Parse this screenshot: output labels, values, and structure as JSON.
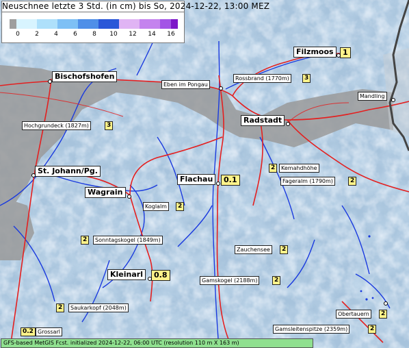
{
  "title": "Neuschnee letzte 3 Std. (in cm) bis So, 2024-12-22, 13:00 MEZ",
  "legend": {
    "ticks": [
      "0",
      "2",
      "4",
      "6",
      "8",
      "10",
      "12",
      "14",
      "16"
    ],
    "colors": [
      "#9e9e9e",
      "#d8f4ff",
      "#aee0fb",
      "#7ec0f5",
      "#4f8fe8",
      "#2a57d8",
      "#e0b4f4",
      "#c483ee",
      "#a354e6",
      "#7d18c8"
    ]
  },
  "places": [
    {
      "name": "Filzmoos",
      "value": "1",
      "size": "big"
    },
    {
      "name": "Bischofshofen",
      "value": "",
      "size": "big"
    },
    {
      "name": "Eben im Pongau",
      "value": "",
      "size": "small"
    },
    {
      "name": "Rossbrand (1770m)",
      "value": "3",
      "size": "small"
    },
    {
      "name": "Mandling",
      "value": "",
      "size": "small"
    },
    {
      "name": "Radstadt",
      "value": "",
      "size": "big"
    },
    {
      "name": "Hochgrundeck (1827m)",
      "value": "3",
      "size": "small"
    },
    {
      "name": "St. Johann/Pg.",
      "value": "",
      "size": "big"
    },
    {
      "name": "Kemahdhöhe",
      "value": "2",
      "size": "small"
    },
    {
      "name": "Fageralm (1790m)",
      "value": "2",
      "size": "small"
    },
    {
      "name": "Flachau",
      "value": "0.1",
      "size": "big"
    },
    {
      "name": "Wagrain",
      "value": "",
      "size": "big"
    },
    {
      "name": "Koglalm",
      "value": "2",
      "size": "small"
    },
    {
      "name": "Sonntagskogel (1849m)",
      "value": "2",
      "size": "small"
    },
    {
      "name": "Zauchensee",
      "value": "2",
      "size": "small"
    },
    {
      "name": "Kleinarl",
      "value": "0.8",
      "size": "big"
    },
    {
      "name": "Gamskogel (2188m)",
      "value": "2",
      "size": "small"
    },
    {
      "name": "Saukarkopf (2048m)",
      "value": "2",
      "size": "small"
    },
    {
      "name": "Obertauern",
      "value": "2",
      "size": "small"
    },
    {
      "name": "Grossarl",
      "value": "0.2",
      "size": "small"
    },
    {
      "name": "Gamsleitenspitze (2359m)",
      "value": "2",
      "size": "small"
    }
  ],
  "footer": "GFS-based MetGIS Fcst. initialized 2024-12-22, 06:00 UTC  (resolution 110 m X 163 m)"
}
